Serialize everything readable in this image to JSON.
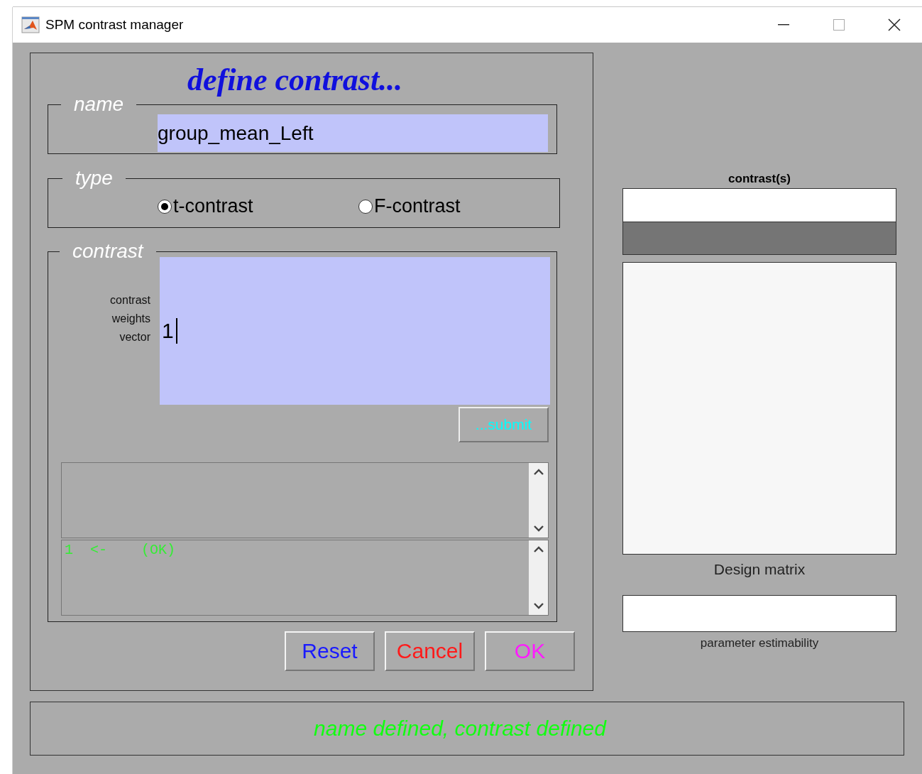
{
  "window": {
    "title": "SPM contrast manager"
  },
  "panel": {
    "heading": "define contrast...",
    "name_group": {
      "legend": "name",
      "value": "group_mean_Left"
    },
    "type_group": {
      "legend": "type",
      "options": [
        {
          "label": "t-contrast",
          "selected": true
        },
        {
          "label": "F-contrast",
          "selected": false
        }
      ]
    },
    "contrast_group": {
      "legend": "contrast",
      "weights_label": "contrast weights vector",
      "value": "1",
      "submit": "...submit",
      "output_lines": [
        "1  <-    (OK)"
      ]
    },
    "buttons": [
      {
        "label": "Reset",
        "color": "#1a1aff"
      },
      {
        "label": "Cancel",
        "color": "#ff1a1a"
      },
      {
        "label": "OK",
        "color": "#ff1aff"
      }
    ]
  },
  "right": {
    "contrasts_title": "contrast(s)",
    "design_matrix_label": "Design matrix",
    "estimability_label": "parameter estimability"
  },
  "status": "name defined, contrast defined"
}
